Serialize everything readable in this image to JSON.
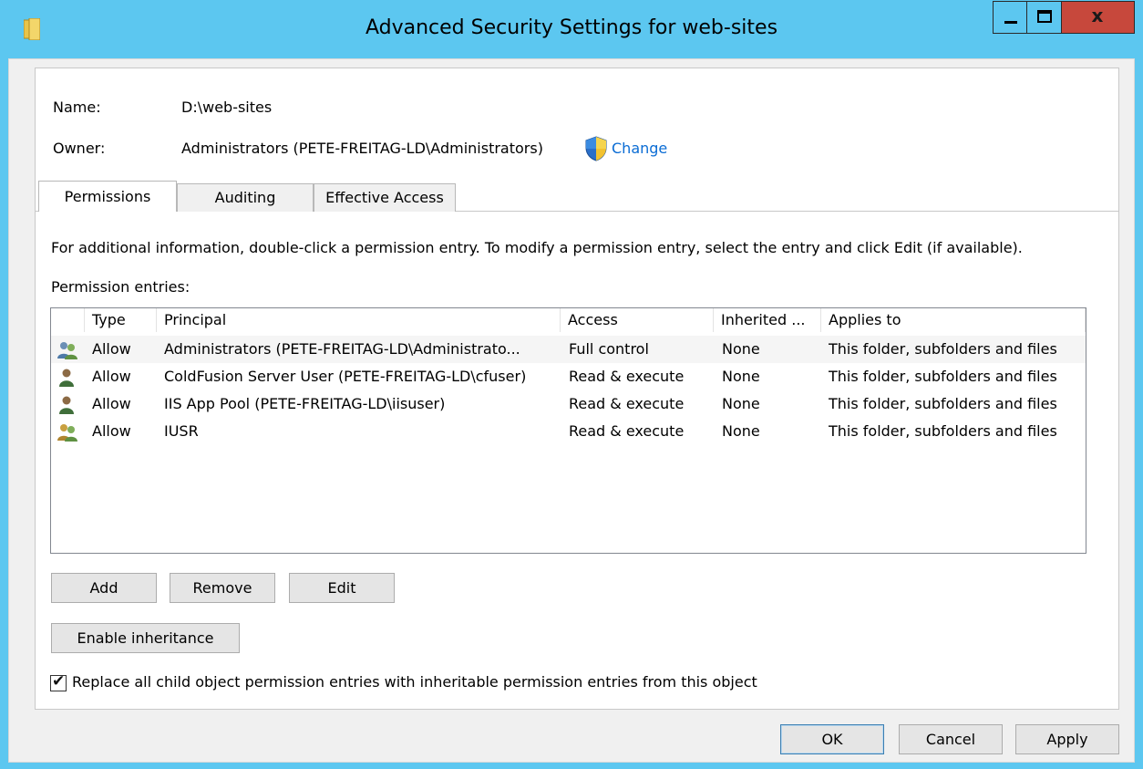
{
  "window": {
    "title": "Advanced Security Settings for web-sites",
    "close_glyph": "x",
    "accent_color": "#5cc7f0",
    "close_color": "#c7483c"
  },
  "info": {
    "name_label": "Name:",
    "name_value": "D:\\web-sites",
    "owner_label": "Owner:",
    "owner_value": "Administrators (PETE-FREITAG-LD\\Administrators)",
    "change_link": "Change"
  },
  "tabs": [
    {
      "label": "Permissions",
      "active": true
    },
    {
      "label": "Auditing",
      "active": false
    },
    {
      "label": "Effective Access",
      "active": false
    }
  ],
  "instructions": "For additional information, double-click a permission entry. To modify a permission entry, select the entry and click Edit (if available).",
  "entries_label": "Permission entries:",
  "table": {
    "columns": [
      "Type",
      "Principal",
      "Access",
      "Inherited ...",
      "Applies to"
    ],
    "rows": [
      {
        "icon": "group-icon",
        "type": "Allow",
        "principal": "Administrators (PETE-FREITAG-LD\\Administrato...",
        "access": "Full control",
        "inherited": "None",
        "applies": "This folder, subfolders and files"
      },
      {
        "icon": "user-icon",
        "type": "Allow",
        "principal": "ColdFusion Server User (PETE-FREITAG-LD\\cfuser)",
        "access": "Read & execute",
        "inherited": "None",
        "applies": "This folder, subfolders and files"
      },
      {
        "icon": "user-icon",
        "type": "Allow",
        "principal": "IIS App Pool (PETE-FREITAG-LD\\iisuser)",
        "access": "Read & execute",
        "inherited": "None",
        "applies": "This folder, subfolders and files"
      },
      {
        "icon": "group-icon",
        "type": "Allow",
        "principal": "IUSR",
        "access": "Read & execute",
        "inherited": "None",
        "applies": "This folder, subfolders and files"
      }
    ]
  },
  "buttons": {
    "add": "Add",
    "remove": "Remove",
    "edit": "Edit",
    "enable_inheritance": "Enable inheritance",
    "ok": "OK",
    "cancel": "Cancel",
    "apply": "Apply"
  },
  "replace_checkbox": {
    "checked": true,
    "label": "Replace all child object permission entries with inheritable permission entries from this object"
  }
}
